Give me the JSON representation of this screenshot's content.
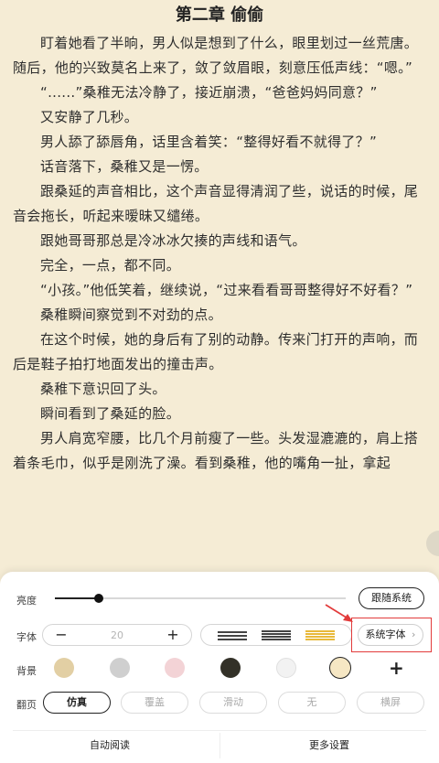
{
  "reader": {
    "chapter_title": "第二章 偷偷",
    "paragraphs": [
      "盯着她看了半晌，男人似是想到了什么，眼里划过一丝荒唐。随后，他的兴致莫名上来了，敛了敛眉眼，刻意压低声线：“嗯。”",
      "“......”桑稚无法冷静了，接近崩溃，“爸爸妈妈同意？”",
      "又安静了几秒。",
      "男人舔了舔唇角，话里含着笑：“整得好看不就得了？”",
      "话音落下，桑稚又是一愣。",
      "跟桑延的声音相比，这个声音显得清润了些，说话的时候，尾音会拖长，听起来暧昧又缱绻。",
      "跟她哥哥那总是冷冰冰欠揍的声线和语气。",
      "完全，一点，都不同。",
      "“小孩。”他低笑着，继续说，“过来看看哥哥整得好不好看？”",
      "桑稚瞬间察觉到不对劲的点。",
      "在这个时候，她的身后有了别的动静。传来门打开的声响，而后是鞋子拍打地面发出的撞击声。",
      "桑稚下意识回了头。",
      "瞬间看到了桑延的脸。",
      "男人肩宽窄腰，比几个月前瘦了一些。头发湿漉漉的，肩上搭着条毛巾，似乎是刚洗了澡。看到桑稚，他的嘴角一扯，拿起"
    ]
  },
  "settings": {
    "brightness": {
      "label": "亮度",
      "level_percent": 15,
      "follow_system_label": "跟随系统"
    },
    "font": {
      "label": "字体",
      "minus": "−",
      "size_value": "20",
      "plus": "+",
      "spacing_options": [
        "compact",
        "normal",
        "loose"
      ],
      "spacing_selected": "loose",
      "system_font_label": "系统字体",
      "system_font_chevron": "›"
    },
    "background": {
      "label": "背景",
      "swatches": [
        "#e2cfa4",
        "#cfcfcf",
        "#f3d3d6",
        "#333128",
        "#f2f2f2",
        "#f6e7c4"
      ],
      "selected_index": 5,
      "add_label": "+"
    },
    "page_turn": {
      "label": "翻页",
      "options": [
        "仿真",
        "覆盖",
        "滑动",
        "无",
        "横屏"
      ],
      "selected_index": 0
    },
    "bottom": {
      "auto_read": "自动阅读",
      "more_settings": "更多设置"
    }
  },
  "colors": {
    "paper_bg": "#f5ecd5",
    "highlight_red": "#e23b3b",
    "spacing_active": "#e8b93a"
  }
}
